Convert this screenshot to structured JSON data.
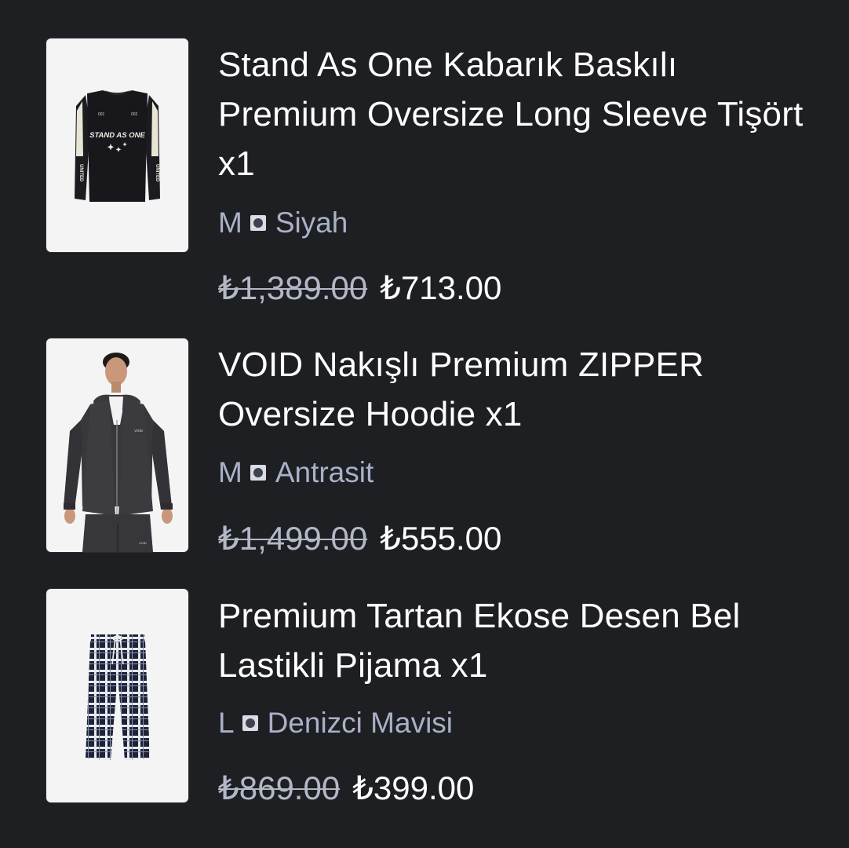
{
  "items": [
    {
      "title": "Stand As One Kabarık Baskılı Premium Oversize Long Sleeve Tişört x1",
      "size": "M",
      "color": "Siyah",
      "old_price": "₺1,389.00",
      "price": "₺713.00",
      "image": "black-long-sleeve-tshirt"
    },
    {
      "title": "VOID Nakışlı Premium ZIPPER Oversize Hoodie x1",
      "size": "M",
      "color": "Antrasit",
      "old_price": "₺1,499.00",
      "price": "₺555.00",
      "image": "anthracite-zip-hoodie-model"
    },
    {
      "title": "Premium Tartan Ekose Desen Bel Lastikli Pijama x1",
      "size": "L",
      "color": "Denizci Mavisi",
      "old_price": "₺869.00",
      "price": "₺399.00",
      "image": "navy-tartan-pajama-pants"
    }
  ],
  "tshirt_print": {
    "front_text": "STAND AS ONE",
    "sleeve_text": "UNITED",
    "chest_left": "001",
    "chest_right": "002"
  },
  "hoodie_print": {
    "chest_text": "VOID"
  }
}
